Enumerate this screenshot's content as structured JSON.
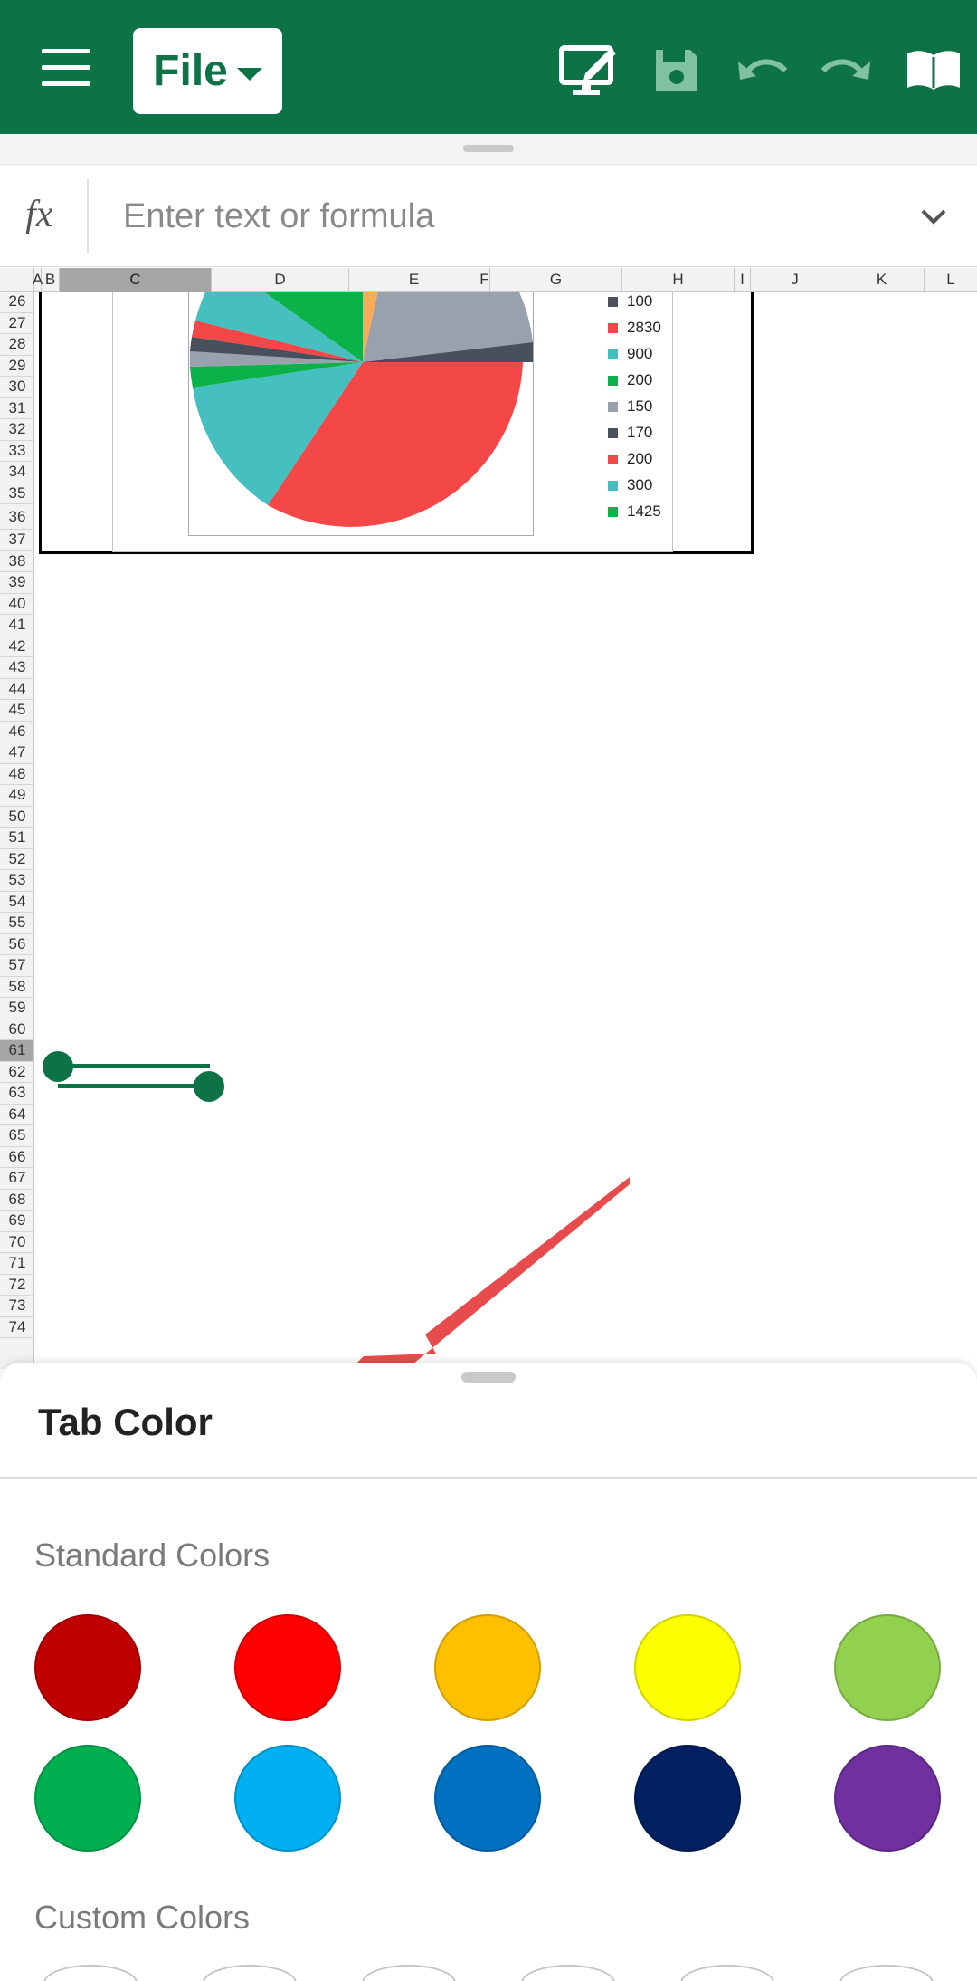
{
  "toolbar": {
    "file_label": "File",
    "icons": [
      "menu-icon",
      "edit-mode-icon",
      "save-icon",
      "undo-icon",
      "redo-icon",
      "book-icon"
    ],
    "bg_color": "#0e7247"
  },
  "formula": {
    "fx_label": "fx",
    "placeholder": "Enter text or formula"
  },
  "grid": {
    "columns": [
      "A",
      "B",
      "C",
      "D",
      "E",
      "F",
      "G",
      "H",
      "I",
      "J",
      "K",
      "L"
    ],
    "selected_column": "C",
    "rows": [
      "26",
      "27",
      "28",
      "29",
      "30",
      "31",
      "32",
      "33",
      "34",
      "35",
      "36",
      "37",
      "38",
      "39",
      "40",
      "41",
      "42",
      "43",
      "44",
      "45",
      "46",
      "47",
      "48",
      "49",
      "50",
      "51",
      "52",
      "53",
      "54",
      "55",
      "56",
      "57",
      "58",
      "59",
      "60",
      "61",
      "62",
      "63",
      "64",
      "65",
      "66",
      "67",
      "68",
      "69",
      "70",
      "71",
      "72",
      "73",
      "74"
    ],
    "selected_row": "61"
  },
  "chart": {
    "type": "pie",
    "legend": [
      {
        "label": "100",
        "color": "#4a4f5c"
      },
      {
        "label": "2830",
        "color": "#f44747"
      },
      {
        "label": "900",
        "color": "#45bfbf"
      },
      {
        "label": "200",
        "color": "#0bb24a"
      },
      {
        "label": "150",
        "color": "#9aa1ae"
      },
      {
        "label": "170",
        "color": "#4a4f5c"
      },
      {
        "label": "200",
        "color": "#f44747"
      },
      {
        "label": "300",
        "color": "#45bfbf"
      },
      {
        "label": "1425",
        "color": "#0bb24a"
      }
    ]
  },
  "annotation": {
    "arrow_color": "#e84b4b"
  },
  "sheet": {
    "title": "Tab Color",
    "standard_label": "Standard Colors",
    "custom_label": "Custom Colors",
    "standard_colors": [
      "#c00000",
      "#ff0000",
      "#ffc000",
      "#ffff00",
      "#92d050",
      "#00b050",
      "#00b0f0",
      "#0070c0",
      "#002060",
      "#7030a0"
    ]
  }
}
